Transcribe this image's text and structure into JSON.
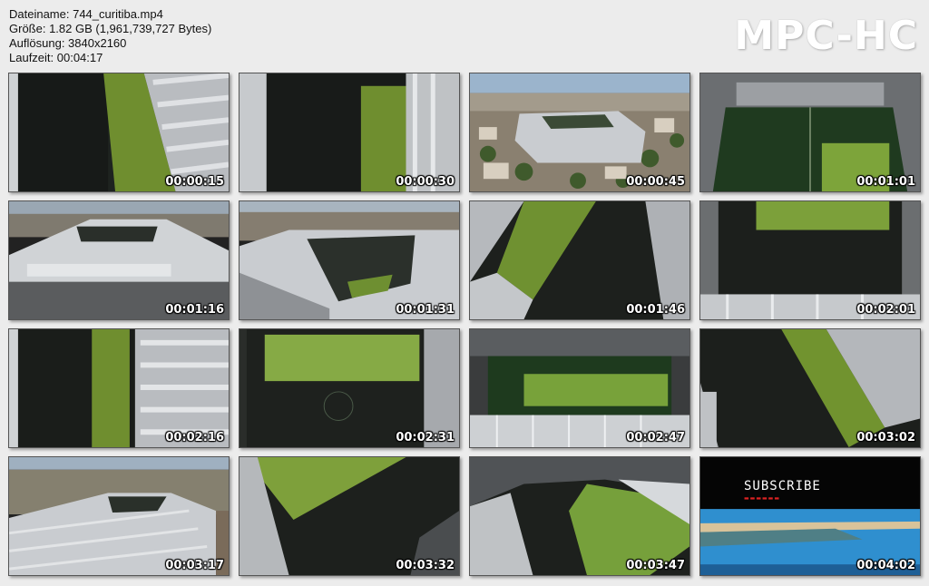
{
  "file_info": {
    "filename": "Dateiname: 744_curitiba.mp4",
    "size": "Größe: 1.82 GB (1,961,739,727 Bytes)",
    "resolution": "Auflösung: 3840x2160",
    "duration": "Laufzeit: 00:04:17"
  },
  "logo": "MPC-HC",
  "thumbnails": [
    {
      "timestamp": "00:00:15",
      "scene": "roof-aerial-left"
    },
    {
      "timestamp": "00:00:30",
      "scene": "roof-aerial-center"
    },
    {
      "timestamp": "00:00:45",
      "scene": "city-stadium-wide"
    },
    {
      "timestamp": "00:01:01",
      "scene": "pitch-interior"
    },
    {
      "timestamp": "00:01:16",
      "scene": "stadium-exterior-close"
    },
    {
      "timestamp": "00:01:31",
      "scene": "stadium-exterior-angle"
    },
    {
      "timestamp": "00:01:46",
      "scene": "pitch-diagonal"
    },
    {
      "timestamp": "00:02:01",
      "scene": "pitch-top-edge"
    },
    {
      "timestamp": "00:02:16",
      "scene": "roof-aerial-left"
    },
    {
      "timestamp": "00:02:31",
      "scene": "pitch-top-down"
    },
    {
      "timestamp": "00:02:47",
      "scene": "pitch-interior-wide"
    },
    {
      "timestamp": "00:03:02",
      "scene": "pitch-diagonal-right"
    },
    {
      "timestamp": "00:03:17",
      "scene": "stadium-exterior-low"
    },
    {
      "timestamp": "00:03:32",
      "scene": "pitch-diagonal-left"
    },
    {
      "timestamp": "00:03:47",
      "scene": "pitch-corner"
    },
    {
      "timestamp": "00:04:02",
      "scene": "subscribe-endcard",
      "subscribe_text": "SUBSCRIBE"
    }
  ]
}
